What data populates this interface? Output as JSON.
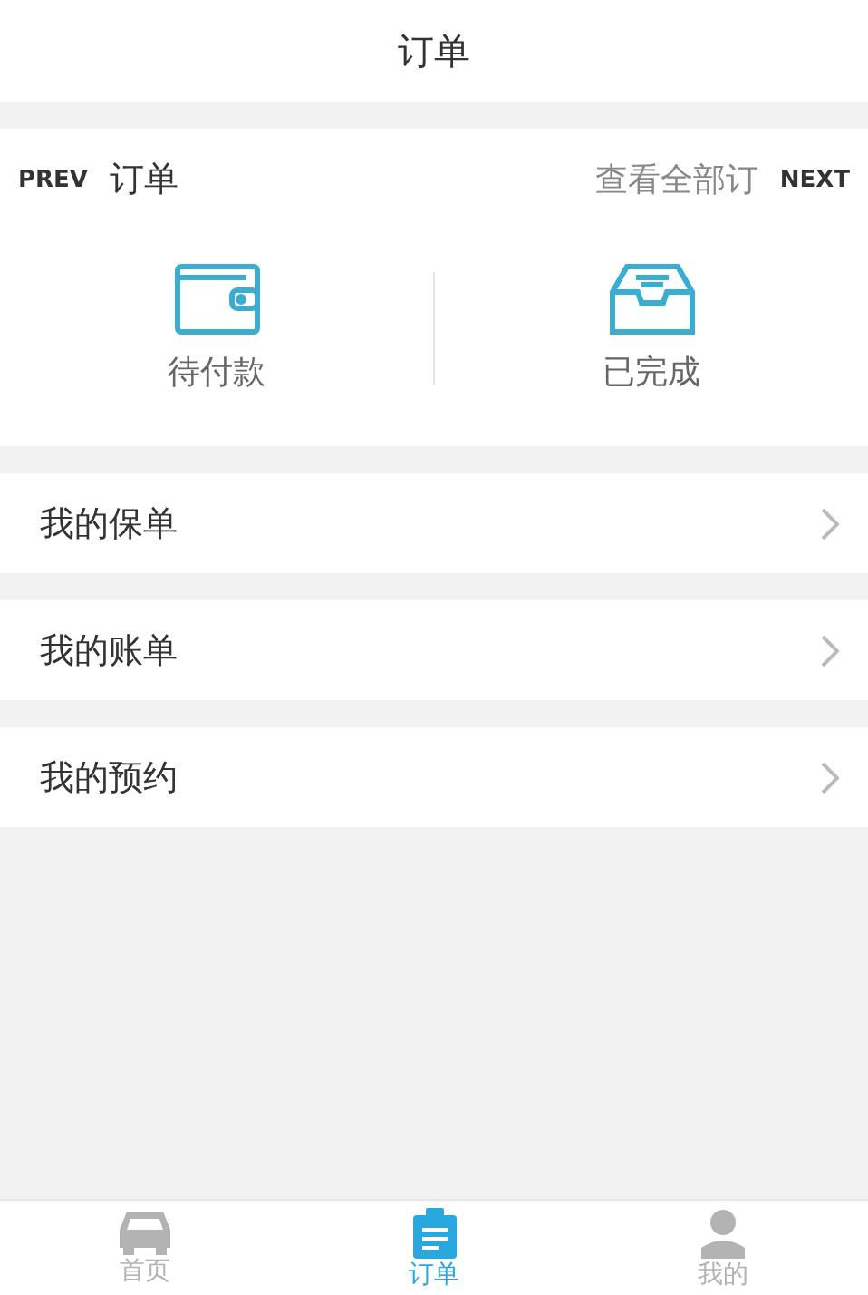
{
  "header": {
    "title": "订单"
  },
  "orders": {
    "title": "订单",
    "view_all": "查看全部订",
    "prev": "PREV",
    "next": "NEXT",
    "items": [
      {
        "kind": "wallet",
        "label": "待付款"
      },
      {
        "kind": "tray",
        "label": "已完成"
      }
    ]
  },
  "menu": [
    {
      "label": "我的保单"
    },
    {
      "label": "我的账单"
    },
    {
      "label": "我的预约"
    }
  ],
  "tabs": [
    {
      "kind": "car",
      "label": "首页",
      "selected": false
    },
    {
      "kind": "clipboard",
      "label": "订单",
      "selected": true
    },
    {
      "kind": "person",
      "label": "我的",
      "selected": false
    }
  ]
}
